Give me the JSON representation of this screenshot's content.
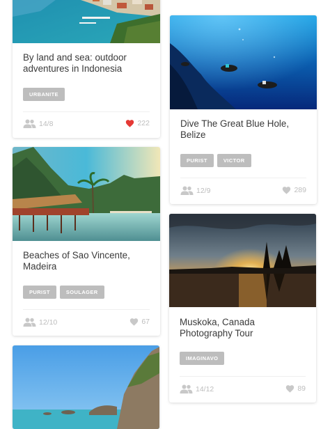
{
  "colors": {
    "tag_bg": "#bdbdbd",
    "meta_text": "#bdbdbd",
    "heart_active": "#e53935",
    "heart_inactive": "#c8c8c8"
  },
  "cards": [
    {
      "title": "By land and sea: outdoor adventures in Indonesia",
      "tags": [
        "URBANITE"
      ],
      "people": "14/8",
      "likes": "222",
      "liked": true,
      "image": "coastal-harbor-town"
    },
    {
      "title": "Dive The Great Blue Hole, Belize",
      "tags": [
        "PURIST",
        "VICTOR"
      ],
      "people": "12/9",
      "likes": "289",
      "liked": false,
      "image": "scuba-divers-underwater"
    },
    {
      "title": "Beaches of Sao Vincente, Madeira",
      "tags": [
        "PURIST",
        "SOULAGER"
      ],
      "people": "12/10",
      "likes": "67",
      "liked": false,
      "image": "tropical-bungalows-lagoon"
    },
    {
      "title": "Muskoka, Canada Photography Tour",
      "tags": [
        "IMAGINAVO"
      ],
      "people": "14/12",
      "likes": "89",
      "liked": false,
      "image": "lake-sunset-pines"
    },
    {
      "image": "rocky-coast-blue-sky"
    }
  ]
}
